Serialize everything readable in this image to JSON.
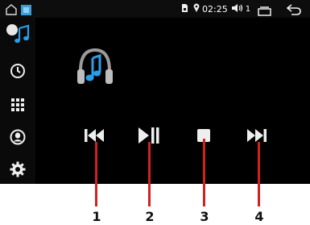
{
  "status_bar": {
    "time": "02:25",
    "volume": "1",
    "left_icons": [
      "home-outline-icon",
      "app-thumbnail-icon"
    ],
    "right_icons": [
      "sim-card-icon",
      "location-pin-icon",
      "volume-icon",
      "recent-apps-icon",
      "back-arrow-icon"
    ]
  },
  "sidebar": {
    "items": [
      {
        "icon": "music-note-icon",
        "active": true
      },
      {
        "icon": "clock-icon",
        "active": false
      },
      {
        "icon": "apps-grid-icon",
        "active": false
      },
      {
        "icon": "contact-icon",
        "active": false
      },
      {
        "icon": "gear-icon",
        "active": false
      }
    ]
  },
  "album_art": {
    "icon": "headphones-music-icon"
  },
  "controls": [
    {
      "icon": "previous-track-icon",
      "callout": "1"
    },
    {
      "icon": "play-pause-icon",
      "callout": "2"
    },
    {
      "icon": "stop-icon",
      "callout": "3"
    },
    {
      "icon": "next-track-icon",
      "callout": "4"
    }
  ],
  "colors": {
    "accent_blue": "#2a9ee8",
    "callout_red": "#d32020",
    "screen_bg": "#000000"
  }
}
